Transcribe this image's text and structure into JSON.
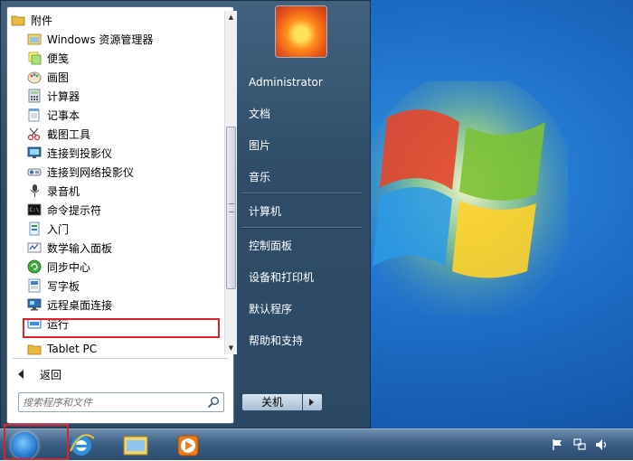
{
  "programs_list": {
    "items": [
      {
        "label": "附件",
        "icon": "folder-icon",
        "type": "folder"
      },
      {
        "label": "Windows 资源管理器",
        "icon": "explorer-icon",
        "type": "program"
      },
      {
        "label": "便笺",
        "icon": "sticky-notes-icon",
        "type": "program"
      },
      {
        "label": "画图",
        "icon": "paint-icon",
        "type": "program"
      },
      {
        "label": "计算器",
        "icon": "calculator-icon",
        "type": "program"
      },
      {
        "label": "记事本",
        "icon": "notepad-icon",
        "type": "program"
      },
      {
        "label": "截图工具",
        "icon": "snipping-tool-icon",
        "type": "program"
      },
      {
        "label": "连接到投影仪",
        "icon": "projector-icon",
        "type": "program"
      },
      {
        "label": "连接到网络投影仪",
        "icon": "network-projector-icon",
        "type": "program"
      },
      {
        "label": "录音机",
        "icon": "microphone-icon",
        "type": "program"
      },
      {
        "label": "命令提示符",
        "icon": "command-prompt-icon",
        "type": "program"
      },
      {
        "label": "入门",
        "icon": "getting-started-icon",
        "type": "program"
      },
      {
        "label": "数学输入面板",
        "icon": "math-input-icon",
        "type": "program"
      },
      {
        "label": "同步中心",
        "icon": "sync-center-icon",
        "type": "program"
      },
      {
        "label": "写字板",
        "icon": "wordpad-icon",
        "type": "program"
      },
      {
        "label": "远程桌面连接",
        "icon": "remote-desktop-icon",
        "type": "program"
      },
      {
        "label": "运行",
        "icon": "run-icon",
        "type": "program"
      },
      {
        "label": "Tablet PC",
        "icon": "folder-icon",
        "type": "folder"
      }
    ]
  },
  "back": {
    "label": "返回"
  },
  "search": {
    "placeholder": "搜索程序和文件"
  },
  "right_panel": {
    "user": "Administrator",
    "items": [
      "文档",
      "图片",
      "音乐",
      "计算机",
      "控制面板",
      "设备和打印机",
      "默认程序",
      "帮助和支持"
    ]
  },
  "shutdown": {
    "label": "关机"
  },
  "colors": {
    "highlight_border": "#e0202a",
    "desktop_blue": "#1f6fc8",
    "menu_dark": "#2f4d68"
  },
  "taskbar": {
    "pinned": [
      "internet-explorer-icon",
      "windows-explorer-icon",
      "media-player-icon"
    ],
    "tray": [
      "action-center-flag-icon",
      "network-icon",
      "volume-icon"
    ]
  }
}
